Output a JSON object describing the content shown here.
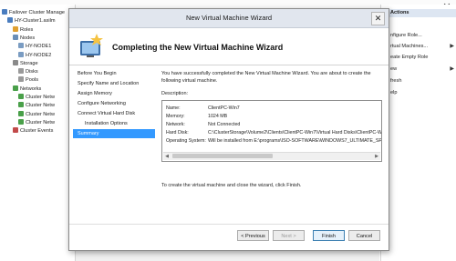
{
  "background": {
    "tree": [
      {
        "label": "Failover Cluster Manage",
        "indent": 0,
        "icon": "cluster-manager-icon"
      },
      {
        "label": "HY-Cluster1.asilm",
        "indent": 1,
        "icon": "cluster-icon"
      },
      {
        "label": "Roles",
        "indent": 2,
        "icon": "roles-icon"
      },
      {
        "label": "Nodes",
        "indent": 2,
        "icon": "nodes-icon"
      },
      {
        "label": "HY-NODE1",
        "indent": 3,
        "icon": "server-icon"
      },
      {
        "label": "HY-NODE2",
        "indent": 3,
        "icon": "server-icon"
      },
      {
        "label": "Storage",
        "indent": 2,
        "icon": "storage-icon"
      },
      {
        "label": "Disks",
        "indent": 3,
        "icon": "disk-icon"
      },
      {
        "label": "Pools",
        "indent": 3,
        "icon": "pool-icon"
      },
      {
        "label": "Networks",
        "indent": 2,
        "icon": "network-icon"
      },
      {
        "label": "Cluster Netw",
        "indent": 3,
        "icon": "network-icon"
      },
      {
        "label": "Cluster Netw",
        "indent": 3,
        "icon": "network-icon"
      },
      {
        "label": "Cluster Netw",
        "indent": 3,
        "icon": "network-icon"
      },
      {
        "label": "Cluster Netw",
        "indent": 3,
        "icon": "network-icon"
      },
      {
        "label": "Cluster Events",
        "indent": 2,
        "icon": "events-icon"
      }
    ],
    "actions": [
      {
        "label": "nfigure Role...",
        "arrow": false
      },
      {
        "label": "rtual Machines...",
        "arrow": true
      },
      {
        "label": "eate Empty Role",
        "arrow": false
      },
      {
        "label": "ew",
        "arrow": true
      },
      {
        "label": "fresh",
        "arrow": false
      },
      {
        "label": "elp",
        "arrow": false
      }
    ],
    "actions_header": "Actions"
  },
  "wizard": {
    "title": "New Virtual Machine Wizard",
    "close_glyph": "✕",
    "heading": "Completing the New Virtual Machine Wizard",
    "steps": [
      {
        "label": "Before You Begin",
        "sub": false,
        "active": false
      },
      {
        "label": "Specify Name and Location",
        "sub": false,
        "active": false
      },
      {
        "label": "Assign Memory",
        "sub": false,
        "active": false
      },
      {
        "label": "Configure Networking",
        "sub": false,
        "active": false
      },
      {
        "label": "Connect Virtual Hard Disk",
        "sub": false,
        "active": false
      },
      {
        "label": "Installation Options",
        "sub": true,
        "active": false
      },
      {
        "label": "Summary",
        "sub": false,
        "active": true
      }
    ],
    "intro": "You have successfully completed the New Virtual Machine Wizard. You are about to create the following virtual machine.",
    "description_label": "Description:",
    "description": [
      {
        "key": "Name:",
        "value": "ClientPC-Win7"
      },
      {
        "key": "Memory:",
        "value": "1024 MB"
      },
      {
        "key": "Network:",
        "value": "Not Connected"
      },
      {
        "key": "Hard Disk:",
        "value": "C:\\ClusterStorage\\Volume2\\Clients\\ClientPC-Win7\\Virtual Hard Disks\\ClientPC-Wi..."
      },
      {
        "key": "Operating System:",
        "value": "Will be installed from E:\\programs\\ISO-SOFTWARE\\WINDOWS7_ULTIMATE_SP1_..."
      }
    ],
    "finish_note": "To create the virtual machine and close the wizard, click Finish.",
    "buttons": {
      "previous": "< Previous",
      "next": "Next >",
      "finish": "Finish",
      "cancel": "Cancel"
    }
  },
  "colors": {
    "accent": "#3399ff",
    "title_bar": "#e1e6ee"
  }
}
